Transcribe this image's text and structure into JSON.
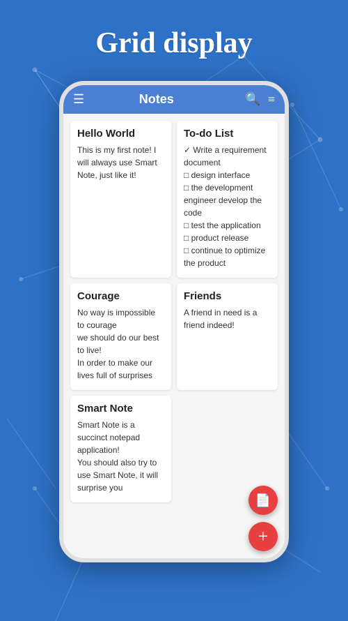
{
  "page": {
    "title": "Grid display",
    "background_color": "#2d6fc7"
  },
  "appbar": {
    "title": "Notes",
    "menu_icon": "☰",
    "search_icon": "🔍",
    "filter_icon": "≡"
  },
  "notes": [
    {
      "id": "hello-world",
      "title": "Hello World",
      "body": "This is my first note! I will always use Smart Note, just like it!"
    },
    {
      "id": "todo-list",
      "title": "To-do List",
      "body": "✓ Write a requirement document\n□ design interface\n□ the development engineer develop the code\n□ test the application\n□ product release\n□ continue to optimize the product"
    },
    {
      "id": "courage",
      "title": "Courage",
      "body": "No way is impossible to courage\nwe should do our best to live!\nIn order to make our lives full of surprises"
    },
    {
      "id": "friends",
      "title": "Friends",
      "body": "A friend in need is a friend indeed!"
    },
    {
      "id": "smart-note",
      "title": "Smart Note",
      "body": "Smart Note is a succinct notepad application!\nYou should also try to use Smart Note, it will surprise you"
    }
  ],
  "fabs": {
    "document_icon": "📄",
    "add_icon": "+"
  }
}
